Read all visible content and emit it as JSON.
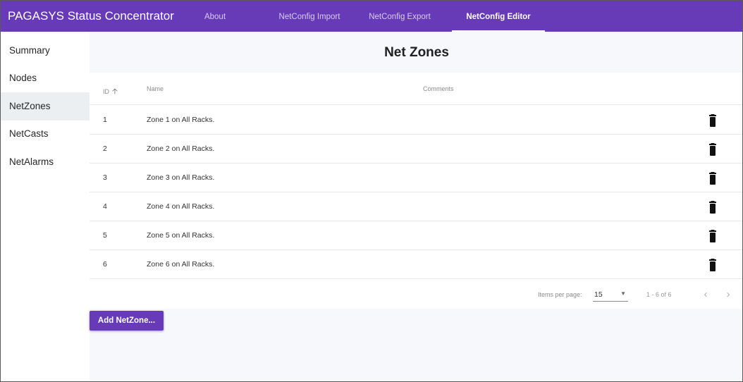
{
  "app": {
    "title": "PAGASYS Status Concentrator"
  },
  "nav": {
    "tabs": [
      {
        "label": "About",
        "active": false
      },
      {
        "label": "NetConfig Import",
        "active": false
      },
      {
        "label": "NetConfig Export",
        "active": false
      },
      {
        "label": "NetConfig Editor",
        "active": true
      }
    ]
  },
  "sidebar": {
    "items": [
      {
        "label": "Summary",
        "active": false
      },
      {
        "label": "Nodes",
        "active": false
      },
      {
        "label": "NetZones",
        "active": true
      },
      {
        "label": "NetCasts",
        "active": false
      },
      {
        "label": "NetAlarms",
        "active": false
      }
    ]
  },
  "main": {
    "title": "Net Zones",
    "table": {
      "columns": {
        "id": "ID",
        "name": "Name",
        "comments": "Comments"
      },
      "sort": {
        "column": "id",
        "direction": "ascending",
        "icon": "arrow-up-icon"
      },
      "rows": [
        {
          "id": "1",
          "name": "Zone 1 on All Racks.",
          "comments": ""
        },
        {
          "id": "2",
          "name": "Zone 2 on All Racks.",
          "comments": ""
        },
        {
          "id": "3",
          "name": "Zone 3 on All Racks.",
          "comments": ""
        },
        {
          "id": "4",
          "name": "Zone 4 on All Racks.",
          "comments": ""
        },
        {
          "id": "5",
          "name": "Zone 5 on All Racks.",
          "comments": ""
        },
        {
          "id": "6",
          "name": "Zone 6 on All Racks.",
          "comments": ""
        }
      ],
      "row_action_icon": "trash-icon"
    },
    "paginator": {
      "items_per_page_label": "Items per page:",
      "items_per_page": "15",
      "range": "1 - 6 of 6",
      "prev_icon": "chevron-left-icon",
      "next_icon": "chevron-right-icon"
    },
    "add_button": "Add NetZone..."
  },
  "colors": {
    "primary": "#673ab7",
    "toolbar_text": "#ffffff",
    "active_sidebar_bg": "#eceff1",
    "content_bg": "#f6f8fb"
  }
}
